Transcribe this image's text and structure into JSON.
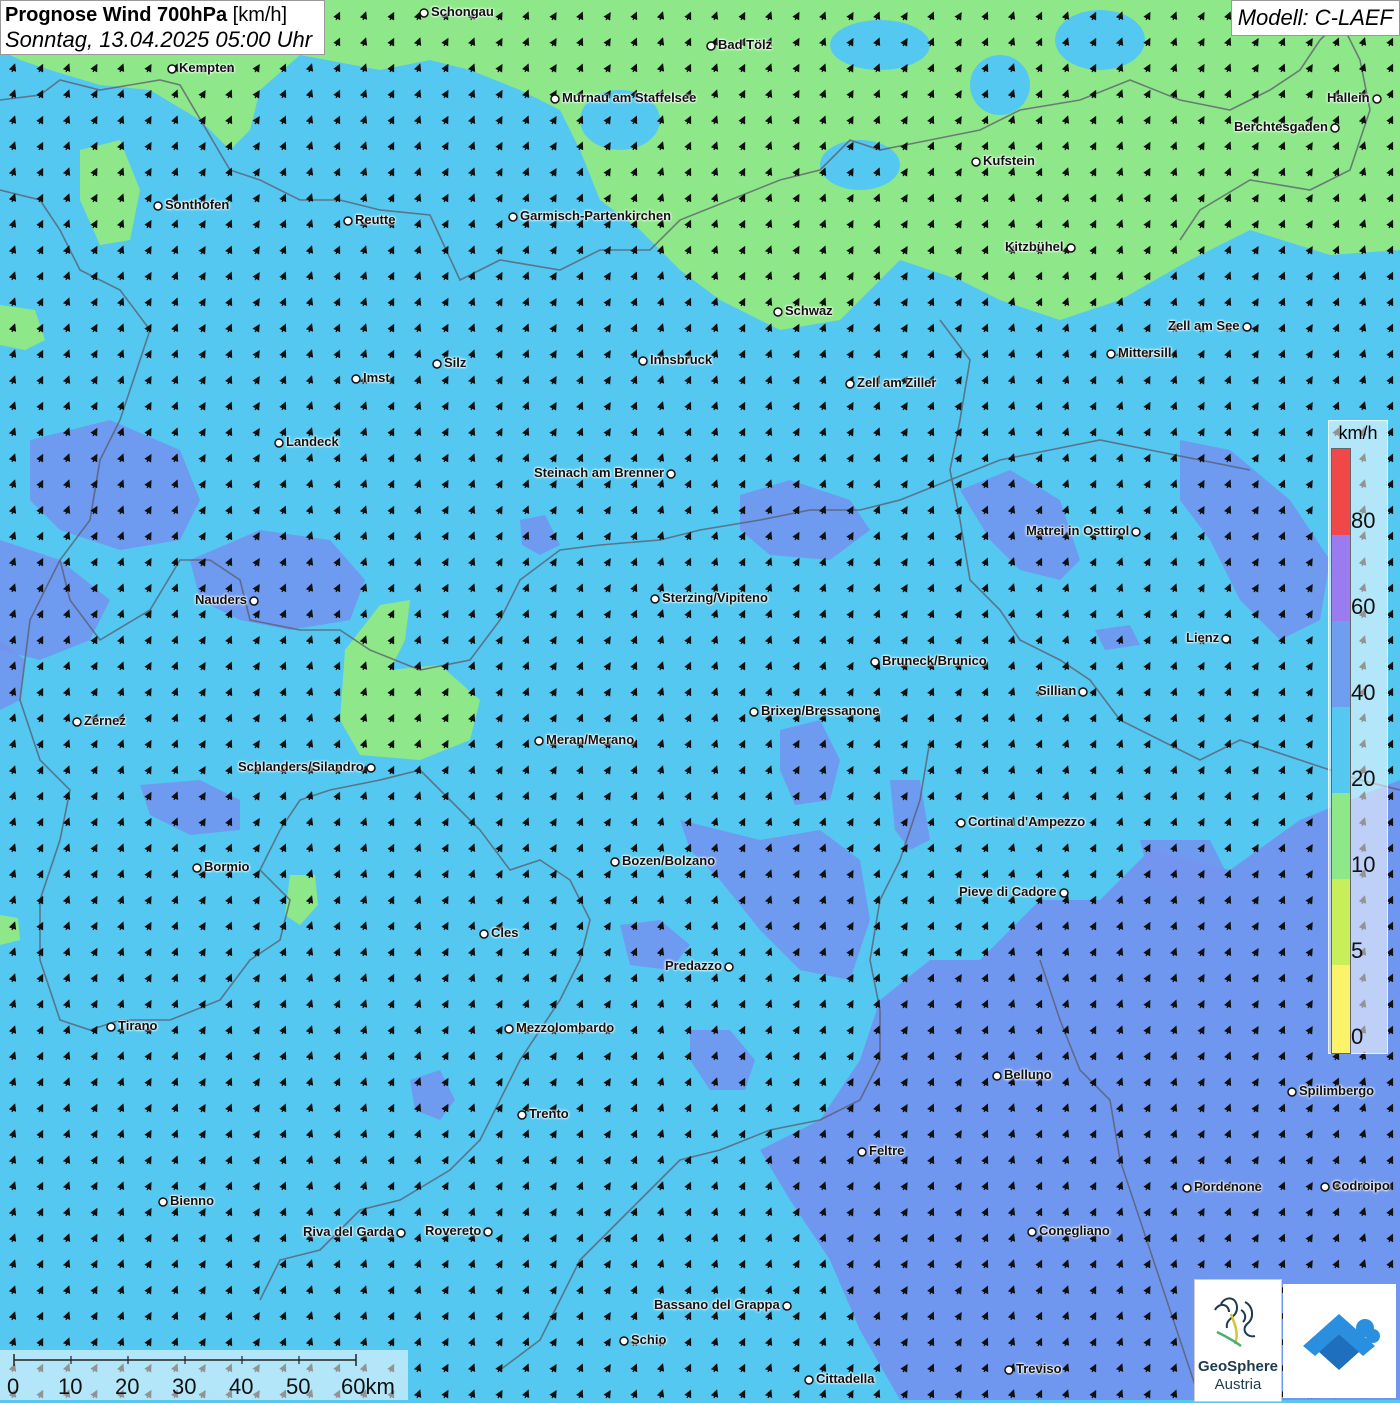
{
  "title": {
    "main_bold": "Prognose Wind 700hPa",
    "main_unit": "[km/h]",
    "subtitle": "Sonntag, 13.04.2025 05:00 Uhr"
  },
  "model_label": "Modell: C-LAEF",
  "legend": {
    "unit": "km/h",
    "ticks": [
      "0",
      "5",
      "10",
      "20",
      "40",
      "60",
      "80"
    ],
    "colors": [
      "#fbf46a",
      "#c8ef5a",
      "#8ee88a",
      "#54c8f0",
      "#6f9df0",
      "#9a7cf0",
      "#f04848"
    ]
  },
  "scale_bar": {
    "labels": [
      "0",
      "10",
      "20",
      "30",
      "40",
      "50",
      "60km"
    ]
  },
  "logos": {
    "geosphere_line1": "GeoSphere",
    "geosphere_line2": "Austria"
  },
  "colors": {
    "calm_green": "#8ee88a",
    "wind_cyan": "#54c8f0",
    "wind_blue": "#7393ef",
    "wind_violet": "#8a80ea"
  },
  "cities": [
    {
      "name": "Schongau"
    },
    {
      "name": "Bad Tölz"
    },
    {
      "name": "Kempten"
    },
    {
      "name": "Murnau am Staffelsee"
    },
    {
      "name": "Hallein"
    },
    {
      "name": "Berchtesgaden"
    },
    {
      "name": "Kufstein"
    },
    {
      "name": "Sonthofen"
    },
    {
      "name": "Reutte"
    },
    {
      "name": "Garmisch-Partenkirchen"
    },
    {
      "name": "Kitzbühel"
    },
    {
      "name": "Schwaz"
    },
    {
      "name": "Zell am See"
    },
    {
      "name": "Mittersill"
    },
    {
      "name": "Innsbruck"
    },
    {
      "name": "Silz"
    },
    {
      "name": "Imst"
    },
    {
      "name": "Zell am Ziller"
    },
    {
      "name": "Landeck"
    },
    {
      "name": "Steinach am Brenner"
    },
    {
      "name": "Matrei in Osttirol"
    },
    {
      "name": "Nauders"
    },
    {
      "name": "Sterzing/Vipiteno"
    },
    {
      "name": "Lienz"
    },
    {
      "name": "Bruneck/Brunico"
    },
    {
      "name": "Sillian"
    },
    {
      "name": "Zernez"
    },
    {
      "name": "Brixen/Bressanone"
    },
    {
      "name": "Meran/Merano"
    },
    {
      "name": "Schlanders/Silandro"
    },
    {
      "name": "Cortina d'Ampezzo"
    },
    {
      "name": "Bormio"
    },
    {
      "name": "Bozen/Bolzano"
    },
    {
      "name": "Pieve di Cadore"
    },
    {
      "name": "Cles"
    },
    {
      "name": "Predazzo"
    },
    {
      "name": "Tirano"
    },
    {
      "name": "Mezzolombardo"
    },
    {
      "name": "Belluno"
    },
    {
      "name": "Spilimbergo"
    },
    {
      "name": "Trento"
    },
    {
      "name": "Feltre"
    },
    {
      "name": "Pordenone"
    },
    {
      "name": "Codroipo"
    },
    {
      "name": "Bienno"
    },
    {
      "name": "Riva del Garda"
    },
    {
      "name": "Rovereto"
    },
    {
      "name": "Conegliano"
    },
    {
      "name": "Bassano del Grappa"
    },
    {
      "name": "Schio"
    },
    {
      "name": "Treviso"
    },
    {
      "name": "Cittadella"
    }
  ]
}
